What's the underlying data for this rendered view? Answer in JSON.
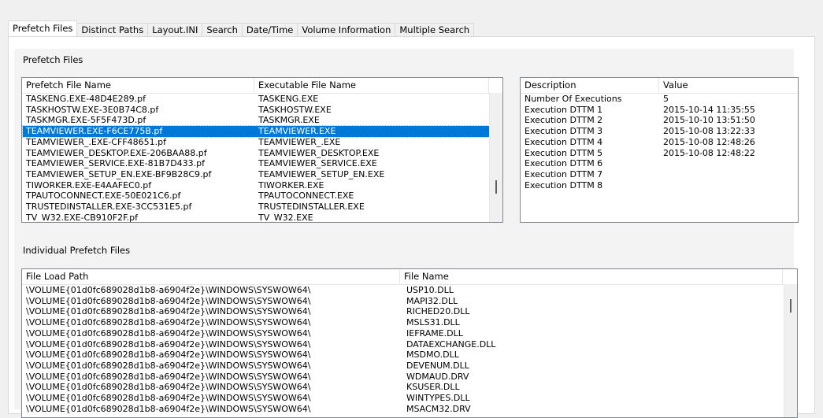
{
  "tabs": [
    "Prefetch Files",
    "Distinct Paths",
    "Layout.INI",
    "Search",
    "Date/Time",
    "Volume Information",
    "Multiple Search"
  ],
  "prefetch_group_label": "Prefetch Files",
  "prefetch_list": {
    "columns": [
      "Prefetch File Name",
      "Executable File Name"
    ],
    "rows": [
      [
        "TASKENG.EXE-48D4E289.pf",
        "TASKENG.EXE"
      ],
      [
        "TASKHOSTW.EXE-3E0B74C8.pf",
        "TASKHOSTW.EXE"
      ],
      [
        "TASKMGR.EXE-5F5F473D.pf",
        "TASKMGR.EXE"
      ],
      [
        "TEAMVIEWER.EXE-F6CE775B.pf",
        "TEAMVIEWER.EXE"
      ],
      [
        "TEAMVIEWER_.EXE-CFF48651.pf",
        "TEAMVIEWER_.EXE"
      ],
      [
        "TEAMVIEWER_DESKTOP.EXE-206BAA88.pf",
        "TEAMVIEWER_DESKTOP.EXE"
      ],
      [
        "TEAMVIEWER_SERVICE.EXE-81B7D433.pf",
        "TEAMVIEWER_SERVICE.EXE"
      ],
      [
        "TEAMVIEWER_SETUP_EN.EXE-BF9B28C9.pf",
        "TEAMVIEWER_SETUP_EN.EXE"
      ],
      [
        "TIWORKER.EXE-E4AAFEC0.pf",
        "TIWORKER.EXE"
      ],
      [
        "TPAUTOCONNECT.EXE-50E021C6.pf",
        "TPAUTOCONNECT.EXE"
      ],
      [
        "TRUSTEDINSTALLER.EXE-3CC531E5.pf",
        "TRUSTEDINSTALLER.EXE"
      ],
      [
        "TV_W32.EXE-CB910F2F.pf",
        "TV_W32.EXE"
      ]
    ],
    "selected_index": 3
  },
  "details_list": {
    "columns": [
      "Description",
      "Value"
    ],
    "rows": [
      [
        "Number Of Executions",
        "5"
      ],
      [
        "Execution DTTM 1",
        "2015-10-14 11:35:55"
      ],
      [
        "Execution DTTM 2",
        "2015-10-10 13:51:50"
      ],
      [
        "Execution DTTM 3",
        "2015-10-08 13:22:33"
      ],
      [
        "Execution DTTM 4",
        "2015-10-08 12:48:26"
      ],
      [
        "Execution DTTM 5",
        "2015-10-08 12:48:22"
      ],
      [
        "Execution DTTM 6",
        ""
      ],
      [
        "Execution DTTM 7",
        ""
      ],
      [
        "Execution DTTM 8",
        ""
      ]
    ]
  },
  "individual_group_label": "Individual Prefetch Files",
  "files_list": {
    "columns": [
      "File Load Path",
      "File Name"
    ],
    "rows": [
      [
        "\\VOLUME{01d0fc689028d1b8-a6904f2e}\\WINDOWS\\SYSWOW64\\",
        "USP10.DLL"
      ],
      [
        "\\VOLUME{01d0fc689028d1b8-a6904f2e}\\WINDOWS\\SYSWOW64\\",
        "MAPI32.DLL"
      ],
      [
        "\\VOLUME{01d0fc689028d1b8-a6904f2e}\\WINDOWS\\SYSWOW64\\",
        "RICHED20.DLL"
      ],
      [
        "\\VOLUME{01d0fc689028d1b8-a6904f2e}\\WINDOWS\\SYSWOW64\\",
        "MSLS31.DLL"
      ],
      [
        "\\VOLUME{01d0fc689028d1b8-a6904f2e}\\WINDOWS\\SYSWOW64\\",
        "IEFRAME.DLL"
      ],
      [
        "\\VOLUME{01d0fc689028d1b8-a6904f2e}\\WINDOWS\\SYSWOW64\\",
        "DATAEXCHANGE.DLL"
      ],
      [
        "\\VOLUME{01d0fc689028d1b8-a6904f2e}\\WINDOWS\\SYSWOW64\\",
        "MSDMO.DLL"
      ],
      [
        "\\VOLUME{01d0fc689028d1b8-a6904f2e}\\WINDOWS\\SYSWOW64\\",
        "DEVENUM.DLL"
      ],
      [
        "\\VOLUME{01d0fc689028d1b8-a6904f2e}\\WINDOWS\\SYSWOW64\\",
        "WDMAUD.DRV"
      ],
      [
        "\\VOLUME{01d0fc689028d1b8-a6904f2e}\\WINDOWS\\SYSWOW64\\",
        "KSUSER.DLL"
      ],
      [
        "\\VOLUME{01d0fc689028d1b8-a6904f2e}\\WINDOWS\\SYSWOW64\\",
        "WINTYPES.DLL"
      ],
      [
        "\\VOLUME{01d0fc689028d1b8-a6904f2e}\\WINDOWS\\SYSWOW64\\",
        "MSACM32.DRV"
      ]
    ]
  },
  "colors": {
    "selection": "#0078d7",
    "border": "#828790"
  }
}
